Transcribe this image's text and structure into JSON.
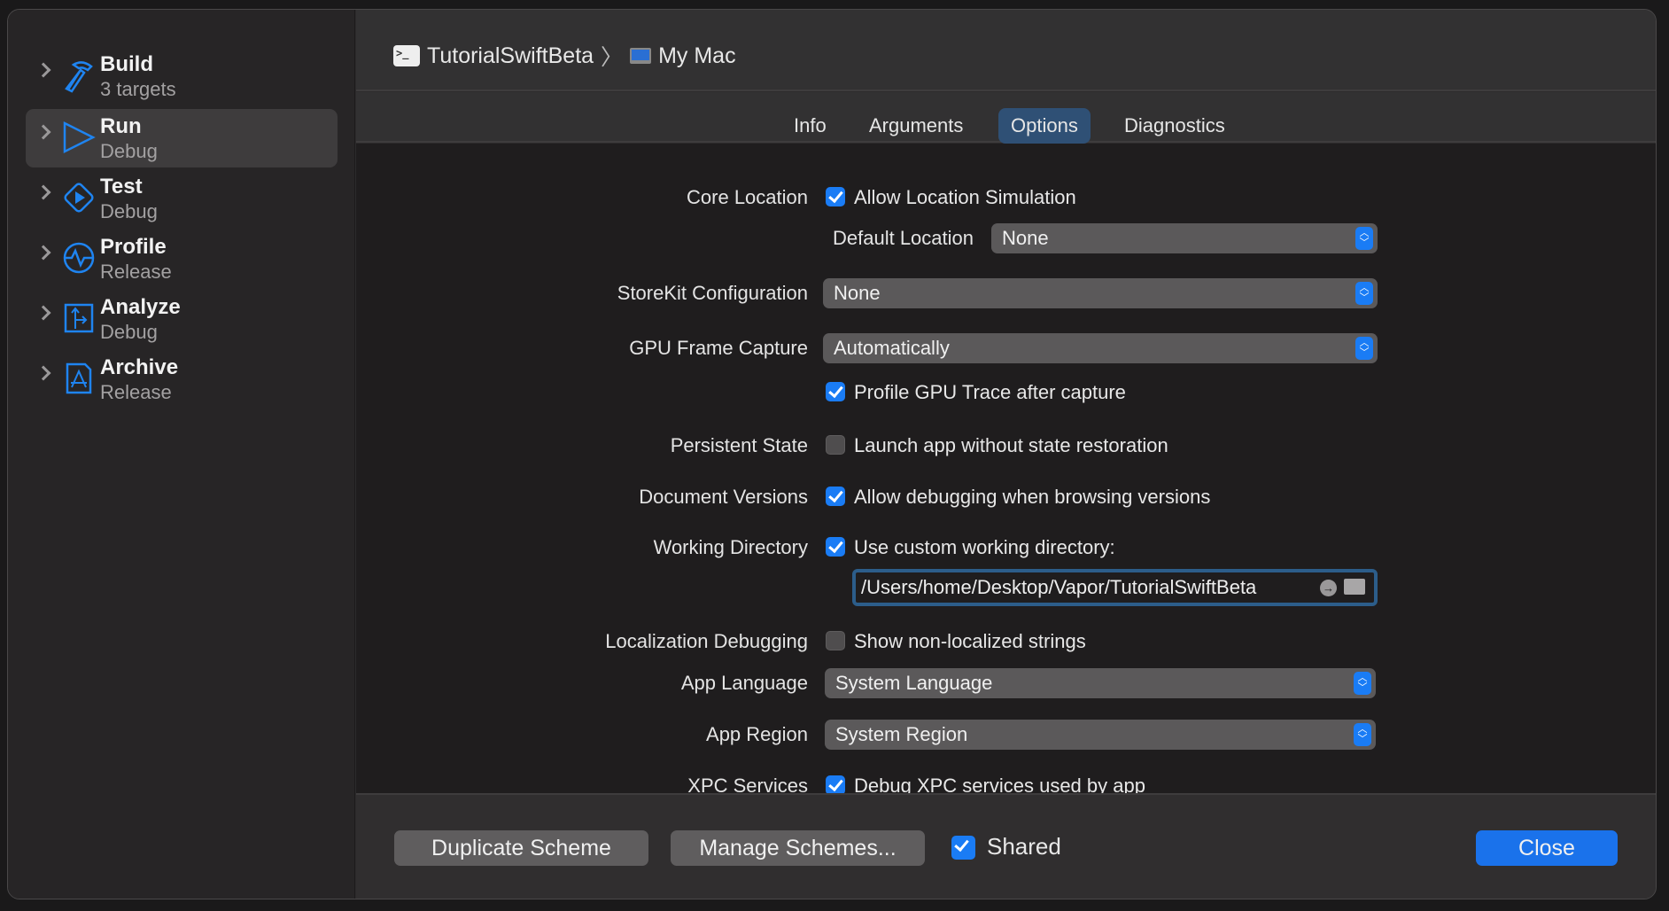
{
  "sidebar": {
    "items": [
      {
        "title": "Build",
        "subtitle": "3 targets",
        "icon": "hammer-icon",
        "selected": false
      },
      {
        "title": "Run",
        "subtitle": "Debug",
        "icon": "play-triangle-icon",
        "selected": true
      },
      {
        "title": "Test",
        "subtitle": "Debug",
        "icon": "test-diamond-icon",
        "selected": false
      },
      {
        "title": "Profile",
        "subtitle": "Release",
        "icon": "waveform-icon",
        "selected": false
      },
      {
        "title": "Analyze",
        "subtitle": "Debug",
        "icon": "analyze-branch-icon",
        "selected": false
      },
      {
        "title": "Archive",
        "subtitle": "Release",
        "icon": "archive-appstore-icon",
        "selected": false
      }
    ]
  },
  "header": {
    "scheme": "TutorialSwiftBeta",
    "separator": "〉",
    "destination": "My Mac"
  },
  "tabs": [
    {
      "label": "Info"
    },
    {
      "label": "Arguments"
    },
    {
      "label": "Options",
      "selected": true
    },
    {
      "label": "Diagnostics"
    }
  ],
  "options": {
    "core_location": {
      "label": "Core Location",
      "checkbox": "Allow Location Simulation",
      "checked": true
    },
    "default_location": {
      "label": "Default Location",
      "value": "None"
    },
    "storekit": {
      "label": "StoreKit Configuration",
      "value": "None"
    },
    "gpu_capture": {
      "label": "GPU Frame Capture",
      "value": "Automatically"
    },
    "gpu_trace": {
      "checkbox": "Profile GPU Trace after capture",
      "checked": true
    },
    "persistent_state": {
      "label": "Persistent State",
      "checkbox": "Launch app without state restoration",
      "checked": false
    },
    "document_versions": {
      "label": "Document Versions",
      "checkbox": "Allow debugging when browsing versions",
      "checked": true
    },
    "working_directory": {
      "label": "Working Directory",
      "checkbox": "Use custom working directory:",
      "checked": true,
      "path": "/Users/home/Desktop/Vapor/TutorialSwiftBeta"
    },
    "localization": {
      "label": "Localization Debugging",
      "checkbox": "Show non-localized strings",
      "checked": false
    },
    "app_language": {
      "label": "App Language",
      "value": "System Language"
    },
    "app_region": {
      "label": "App Region",
      "value": "System Region"
    },
    "xpc": {
      "label": "XPC Services",
      "checkbox": "Debug XPC services used by app",
      "checked": true
    }
  },
  "footer": {
    "duplicate": "Duplicate Scheme",
    "manage": "Manage Schemes...",
    "shared": "Shared",
    "shared_checked": true,
    "close": "Close"
  },
  "colors": {
    "accent": "#1a7cf5",
    "selected_tab": "#2f5075",
    "close_button": "#1a72eb"
  }
}
